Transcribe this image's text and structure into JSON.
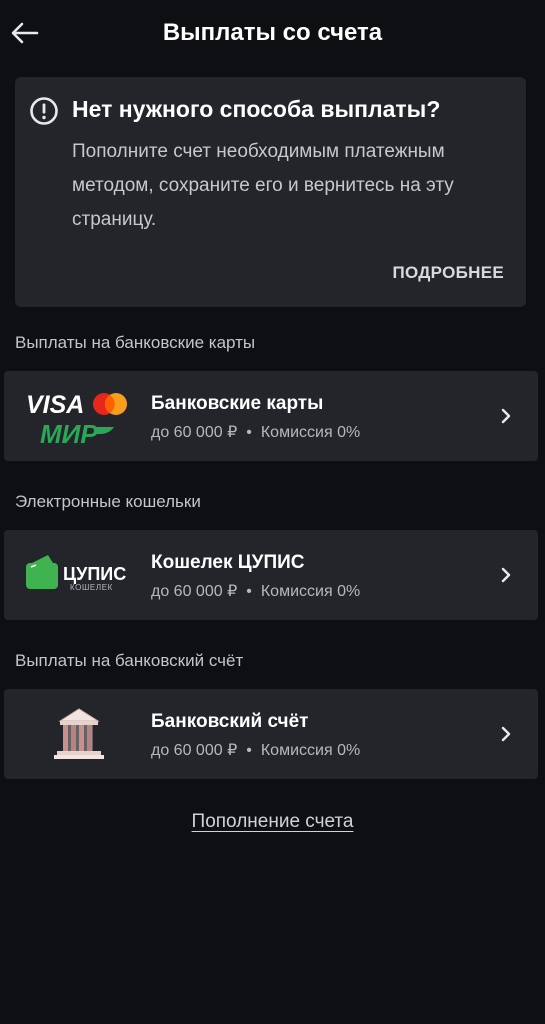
{
  "header": {
    "title": "Выплаты со счета"
  },
  "info": {
    "title": "Нет нужного способа выплаты?",
    "text": "Пополните счет необходимым платежным методом, сохраните его и вернитесь на эту страницу.",
    "more_label": "ПОДРОБНЕЕ"
  },
  "sections": [
    {
      "title": "Выплаты на банковские карты",
      "method": {
        "name": "Банковские карты",
        "limit": "до 60 000 ₽",
        "commission": "Комиссия 0%",
        "logo": {
          "visa": "VISA",
          "mir": "МИР"
        }
      }
    },
    {
      "title": "Электронные кошельки",
      "method": {
        "name": "Кошелек ЦУПИС",
        "limit": "до 60 000 ₽",
        "commission": "Комиссия 0%",
        "logo": {
          "main": "ЦУПИС",
          "sub": "КОШЕЛЕК"
        }
      }
    },
    {
      "title": "Выплаты на банковский счёт",
      "method": {
        "name": "Банковский счёт",
        "limit": "до 60 000 ₽",
        "commission": "Комиссия 0%"
      }
    }
  ],
  "footer": {
    "topup_label": "Пополнение счета"
  },
  "colors": {
    "background": "#0e0f12",
    "card": "#23252b",
    "mir_green": "#2aa857",
    "mastercard_red": "#e5271c",
    "mastercard_orange": "#f79e1b",
    "cupis_green": "#3fb34f"
  }
}
